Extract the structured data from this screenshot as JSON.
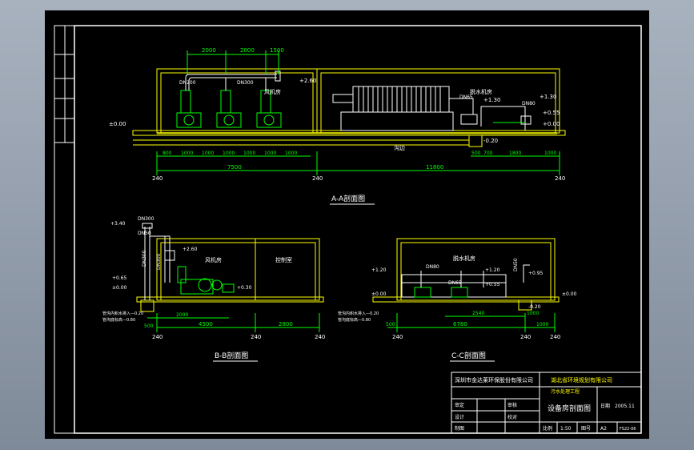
{
  "colors": {
    "background": "#000000",
    "frame": "#ffffff",
    "wall": "#ffff00",
    "dimension": "#00ff00",
    "equipment": "#00ff00",
    "pipe": "#ffffff",
    "text_white": "#ffffff",
    "text_yellow": "#ffff00"
  },
  "section_aa": {
    "title": "A-A剖面图",
    "top_dims": [
      "2000",
      "2000",
      "1500"
    ],
    "bottom_dims_left": [
      "800",
      "1000",
      "1000",
      "1000",
      "1000",
      "1000",
      "1000"
    ],
    "bottom_dims_right": [
      "500",
      "700",
      "1800",
      "1000"
    ],
    "span_dims": [
      "7500",
      "11800"
    ],
    "wall_marks": [
      "240",
      "240",
      "240"
    ],
    "room_labels": [
      "风机房",
      "脱水机房"
    ],
    "pipe_labels": [
      "DN200",
      "DN300",
      "DN65",
      "DN80"
    ],
    "elevations": [
      "±0.00",
      "+2.60",
      "+1.30",
      "+1.30",
      "+0.55",
      "+0.00",
      "-0.20"
    ],
    "trench_label": "沟边"
  },
  "section_bb": {
    "title": "B-B剖面图",
    "bottom_dims": [
      "500",
      "2000",
      "4500",
      "2800"
    ],
    "wall_marks": [
      "240",
      "240",
      "240"
    ],
    "room_labels": [
      "风机房",
      "控制室"
    ],
    "pipe_labels": [
      "DN300",
      "DN50",
      "DN300",
      "DN300"
    ],
    "elevations": [
      "+3.40",
      "+2.60",
      "+0.65",
      "±0.00",
      "+0.30"
    ],
    "notes": [
      "管沟内积水排入—0.20",
      "管沟底标高—0.80"
    ]
  },
  "section_cc": {
    "title": "C-C剖面图",
    "bottom_dims": [
      "500",
      "6780",
      "1000"
    ],
    "sub_dims": [
      "2540",
      "1000"
    ],
    "wall_marks": [
      "240",
      "240",
      "240"
    ],
    "room_labels": [
      "脱水机房"
    ],
    "pipe_labels": [
      "DN80",
      "DN65",
      "DN50"
    ],
    "elevations": [
      "+1.20",
      "+1.20",
      "+0.95",
      "+0.55",
      "±0.00",
      "±0.00",
      "-0.20"
    ],
    "notes": [
      "管沟内积水排入—0.20",
      "管沟底标高—0.80"
    ]
  },
  "title_block": {
    "company_left": "深圳市金达莱环保股份有限公司",
    "company_right": "湖北省环境规划有限公司",
    "project": "设备房剖面图",
    "project_sub": "污水处理工程",
    "labels": [
      "审定",
      "审核",
      "设计",
      "校对",
      "制图",
      "比例",
      "图号",
      "日期"
    ],
    "values": [
      "1:50",
      "A2",
      "FS22-06",
      "2005.11"
    ]
  },
  "revision_strip": {
    "cells": [
      "",
      "",
      "",
      "",
      "",
      ""
    ]
  }
}
